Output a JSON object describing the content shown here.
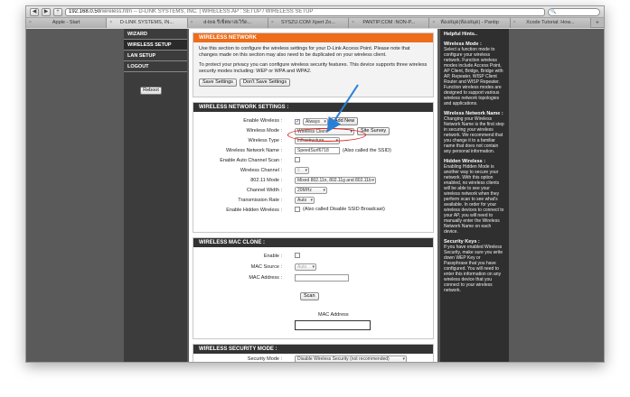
{
  "browser": {
    "url_host": "192.168.0.50",
    "url_path": "/wireless.htm -- D-LINK SYSTEMS, INC. | WIRELESS AP : SETUP / WIRELESS SETUP",
    "back_icon": "left-arrow-icon",
    "forward_icon": "right-arrow-icon",
    "add_icon": "plus-icon",
    "tabs": [
      {
        "label": "Apple - Start"
      },
      {
        "label": "D-LINK SYSTEMS, IN..."
      },
      {
        "label": "d-link รีเซ็ตพาสเวิร์ด..."
      },
      {
        "label": "SYSZU.COM Xpert Zo..."
      },
      {
        "label": "PANTIP.COM :NON-P..."
      },
      {
        "label": "ห้องสมุด(ห้องสมุด) - Pantip"
      },
      {
        "label": "Xcode Tutorial: How..."
      }
    ]
  },
  "nav": {
    "items": [
      "WIZARD",
      "WIRELESS SETUP",
      "LAN SETUP",
      "LOGOUT"
    ],
    "reboot": "Reboot"
  },
  "wireless_network": {
    "title": "WIRELESS NETWORK",
    "para1": "Use this section to configure the wireless settings for your D-Link Access Point. Please note that changes made on this section may also need to be duplicated on your wireless client.",
    "para2": "To protect your privacy you can configure wireless security features. This device supports three wireless security modes including: WEP or WPA and WPA2.",
    "save": "Save Settings",
    "dont_save": "Don't Save Settings"
  },
  "settings": {
    "title": "WIRELESS NETWORK SETTINGS :",
    "enable_label": "Enable Wireless :",
    "enable_value": "Always",
    "add_new": "Add New",
    "mode_label": "Wireless Mode :",
    "mode_value": "Wireless Client",
    "site_survey": "Site Survey",
    "type_label": "Wireless Type :",
    "type_value": "Infrastructure",
    "name_label": "Wireless Network Name :",
    "name_value": "SpeedSurf6718",
    "name_note": "(Also called the SSID)",
    "auto_channel_label": "Enable Auto Channel Scan :",
    "channel_label": "Wireless Channel :",
    "channel_value": "6",
    "mode80211_label": "802.11 Mode :",
    "mode80211_value": "Mixed 802.11n, 802.11g and 802.11b",
    "width_label": "Channel Width :",
    "width_value": "20MHz",
    "rate_label": "Transmission Rate :",
    "rate_value": "Auto",
    "hidden_label": "Enable Hidden Wireless :",
    "hidden_note": "(Also called Disable SSID Broadcast)"
  },
  "mac_clone": {
    "title": "WIRELESS MAC CLONE :",
    "enable_label": "Enable :",
    "source_label": "MAC Source :",
    "source_value": "Auto",
    "address_label": "MAC Address :",
    "scan": "Scan",
    "address_caption": "MAC Address"
  },
  "security": {
    "title": "WIRELESS SECURITY MODE :",
    "mode_label": "Security Mode :",
    "mode_value": "Disable Wireless Security (not recommended)"
  },
  "help": {
    "title": "Helpful Hints..",
    "sections": [
      {
        "heading": "Wireless Mode :",
        "text": "Select a function mode to configure your wireless network. Function wireless modes include Access Point, AP Client, Bridge, Bridge with AP, Repeater, WISP Client Router and WISP Repeater. Function wireless modes are designed to support various wireless network topologies and applications."
      },
      {
        "heading": "Wireless Network Name :",
        "text": "Changing your Wireless Network Name is the first step in securing your wireless network. We recommend that you change it to a familiar name that does not contain any personal information."
      },
      {
        "heading": "Hidden Wireless :",
        "text": "Enabling Hidden Mode is another way to secure your network. With this option enabled, no wireless clients will be able to see your wireless network when they perform scan to see what's available. In order for your wireless devices to connect to your AP, you will need to manually enter the Wireless Network Name on each device."
      },
      {
        "heading": "Security Keys :",
        "text": "If you have enabled Wireless Security, make sure you write down WEP Key or Passphrase that you have configured. You will need to enter this information on any wireless device that you connect to your wireless network."
      }
    ]
  },
  "colors": {
    "orange_header": "#ee6d1a",
    "annotation_red": "#e0201a",
    "annotation_blue": "#2a7fd4"
  }
}
